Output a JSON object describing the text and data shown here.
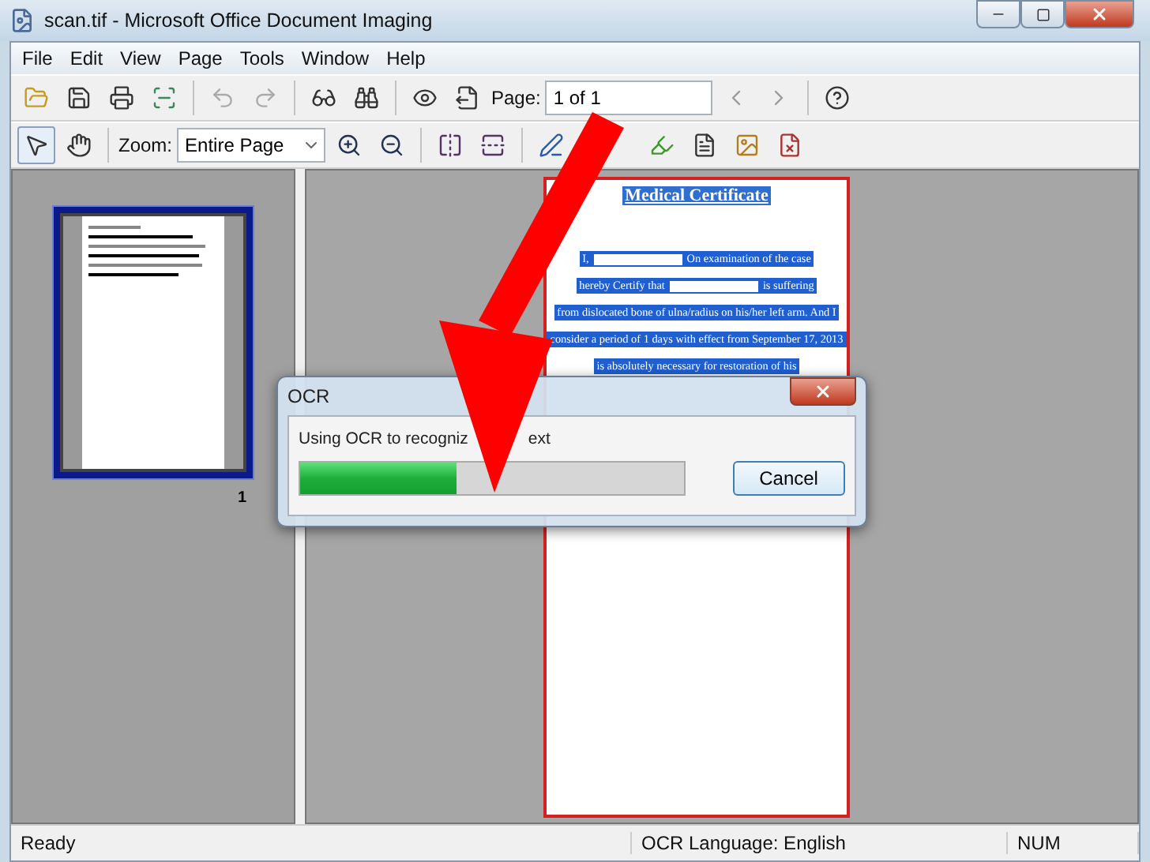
{
  "window": {
    "title": "scan.tif - Microsoft Office Document Imaging"
  },
  "menu": [
    {
      "label": "File"
    },
    {
      "label": "Edit"
    },
    {
      "label": "View"
    },
    {
      "label": "Page"
    },
    {
      "label": "Tools"
    },
    {
      "label": "Window"
    },
    {
      "label": "Help"
    }
  ],
  "page_field": {
    "label": "Page:",
    "value": "1 of 1"
  },
  "zoom": {
    "label": "Zoom:",
    "value": "Entire Page"
  },
  "thumbnails": [
    {
      "label": "1",
      "selected": true
    }
  ],
  "document": {
    "title": "Medical Certificate",
    "lines": [
      [
        {
          "kind": "text",
          "text": "I,"
        },
        {
          "kind": "blank"
        },
        {
          "kind": "text",
          "text": "On examination of the case"
        }
      ],
      [
        {
          "kind": "text",
          "text": "hereby Certify that"
        },
        {
          "kind": "blank"
        },
        {
          "kind": "text",
          "text": "is suffering"
        }
      ],
      [
        {
          "kind": "text",
          "text": "from dislocated bone of ulna/radius on his/her left arm. And I"
        }
      ],
      [
        {
          "kind": "text",
          "text": "consider a period of 1 days with effect from September 17, 2013"
        }
      ],
      [
        {
          "kind": "text",
          "text": "is absolutely necessary for restoration of his"
        }
      ]
    ]
  },
  "dialog": {
    "title": "OCR",
    "message": [
      "Using OCR to recogniz",
      "ext"
    ],
    "progress": {
      "level": 0.41
    },
    "buttons": [
      "Cancel"
    ]
  },
  "status_bar": {
    "status": "Ready",
    "language": "OCR Language: English",
    "indicator": "NUM"
  }
}
